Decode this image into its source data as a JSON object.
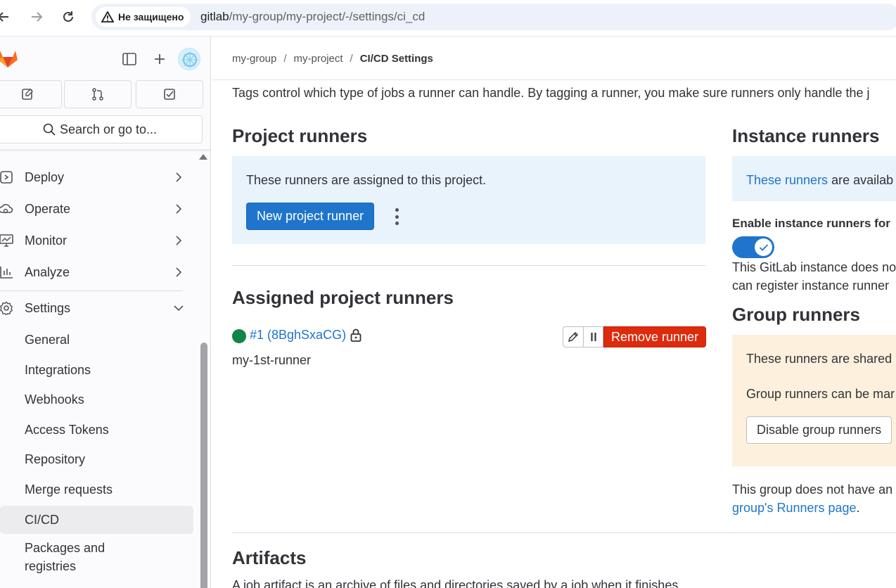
{
  "browser": {
    "security_label": "Не защищено",
    "url_host": "gitlab",
    "url_path": "/my-group/my-project/-/settings/ci_cd"
  },
  "sidebar": {
    "search_placeholder": "Search or go to...",
    "nav": [
      {
        "label": "Deploy",
        "icon": "deploy-icon"
      },
      {
        "label": "Operate",
        "icon": "operate-icon"
      },
      {
        "label": "Monitor",
        "icon": "monitor-icon"
      },
      {
        "label": "Analyze",
        "icon": "analyze-icon"
      },
      {
        "label": "Settings",
        "icon": "settings-icon"
      }
    ],
    "settings_items": [
      "General",
      "Integrations",
      "Webhooks",
      "Access Tokens",
      "Repository",
      "Merge requests",
      "CI/CD",
      "Packages and registries"
    ],
    "active_item": "CI/CD"
  },
  "breadcrumb": [
    "my-group",
    "my-project",
    "CI/CD Settings"
  ],
  "intro_text": "Tags control which type of jobs a runner can handle. By tagging a runner, you make sure runners only handle the j",
  "project_runners": {
    "title": "Project runners",
    "description": "These runners are assigned to this project.",
    "new_button": "New project runner"
  },
  "assigned_runners": {
    "title": "Assigned project runners",
    "runner_link": "#1 (8BghSxaCG)",
    "runner_name": "my-1st-runner",
    "remove_button": "Remove runner",
    "status_color": "#108548"
  },
  "instance_runners": {
    "title": "Instance runners",
    "desc_link": "These runners",
    "desc_rest": " are availab",
    "enable_label": "Enable instance runners for",
    "toggle_on": true,
    "note_line1": "This GitLab instance does no",
    "note_line2": "can register instance runner"
  },
  "group_runners": {
    "title": "Group runners",
    "line1": "These runners are shared",
    "line2": "Group runners can be mar",
    "disable_button": "Disable group runners",
    "footer_text": "This group does not have an",
    "footer_link": "group's Runners page",
    "footer_end": "."
  },
  "artifacts": {
    "title": "Artifacts",
    "text": "A job artifact is an archive of files and directories saved by a job when it finishes."
  },
  "colors": {
    "primary": "#1f75cb",
    "danger": "#dd2b0e",
    "success": "#108548",
    "info_bg": "#e9f3fc",
    "warning_bg": "#fdf1dd"
  }
}
